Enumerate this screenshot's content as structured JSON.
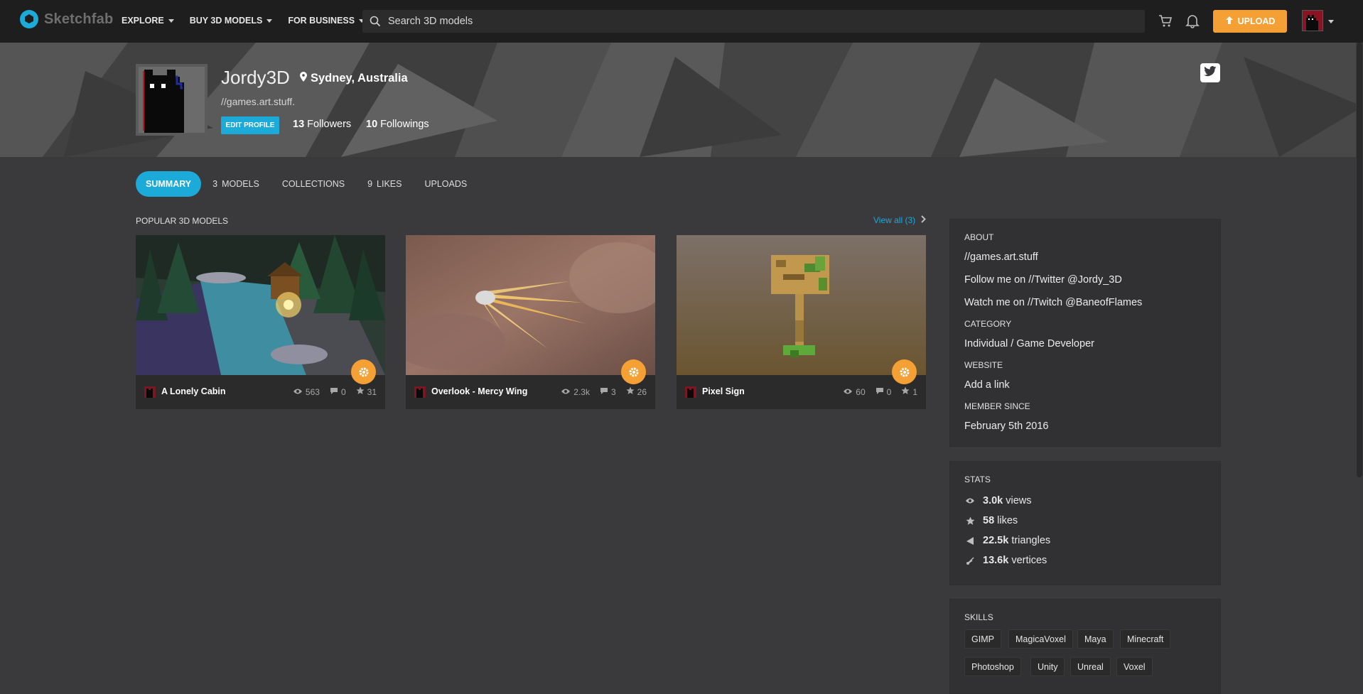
{
  "nav": {
    "logo_text": "Sketchfab",
    "links": [
      "EXPLORE",
      "BUY 3D MODELS",
      "FOR BUSINESS"
    ],
    "search_placeholder": "Search 3D models",
    "upload_label": "UPLOAD"
  },
  "profile": {
    "name": "Jordy3D",
    "location": "Sydney, Australia",
    "tagline": "//games.art.stuff.",
    "edit_label": "EDIT PROFILE",
    "followers_count": "13",
    "followers_label": "Followers",
    "followings_count": "10",
    "followings_label": "Followings"
  },
  "tabs": [
    {
      "count": "",
      "label": "SUMMARY"
    },
    {
      "count": "3",
      "label": "MODELS"
    },
    {
      "count": "",
      "label": "COLLECTIONS"
    },
    {
      "count": "9",
      "label": "LIKES"
    },
    {
      "count": "",
      "label": "UPLOADS"
    }
  ],
  "popular": {
    "title": "POPULAR 3D MODELS",
    "view_all": "View all (3)",
    "models": [
      {
        "title": "A Lonely Cabin",
        "views": "563",
        "comments": "0",
        "likes": "31"
      },
      {
        "title": "Overlook - Mercy Wing",
        "views": "2.3k",
        "comments": "3",
        "likes": "26"
      },
      {
        "title": "Pixel Sign",
        "views": "60",
        "comments": "0",
        "likes": "1"
      }
    ]
  },
  "about": {
    "heading": "ABOUT",
    "lines": [
      "//games.art.stuff",
      "Follow me on //Twitter @Jordy_3D",
      "Watch me on //Twitch @BaneofFlames"
    ],
    "category_heading": "CATEGORY",
    "category": "Individual / Game Developer",
    "website_heading": "WEBSITE",
    "website": "Add a link",
    "member_heading": "MEMBER SINCE",
    "member_since": "February 5th 2016"
  },
  "stats": {
    "heading": "STATS",
    "views_value": "3.0k",
    "views_label": "views",
    "likes_value": "58",
    "likes_label": "likes",
    "triangles_value": "22.5k",
    "triangles_label": "triangles",
    "vertices_value": "13.6k",
    "vertices_label": "vertices"
  },
  "skills": {
    "heading": "SKILLS",
    "items": [
      "GIMP",
      "MagicaVoxel",
      "Maya",
      "Minecraft",
      "Photoshop",
      "Unity",
      "Unreal",
      "Voxel"
    ]
  },
  "colors": {
    "accent": "#1caad9",
    "upload": "#f5a035",
    "nav_bg": "#1e1e1f",
    "page_bg": "#3a3a3c"
  }
}
